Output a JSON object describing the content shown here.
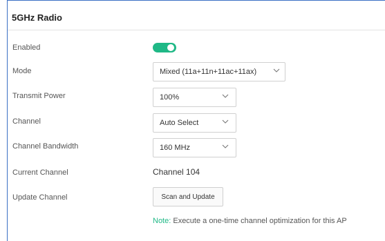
{
  "section": {
    "title": "5GHz Radio"
  },
  "fields": {
    "enabled": {
      "label": "Enabled",
      "value": true
    },
    "mode": {
      "label": "Mode",
      "value": "Mixed (11a+11n+11ac+11ax)"
    },
    "transmit_power": {
      "label": "Transmit Power",
      "value": "100%"
    },
    "channel": {
      "label": "Channel",
      "value": "Auto Select"
    },
    "channel_bandwidth": {
      "label": "Channel Bandwidth",
      "value": "160 MHz"
    },
    "current_channel": {
      "label": "Current Channel",
      "value": "Channel 104"
    },
    "update_channel": {
      "label": "Update Channel",
      "button_label": "Scan and Update"
    }
  },
  "note": {
    "prefix": "Note:",
    "text": " Execute a one-time channel optimization for this AP"
  },
  "colors": {
    "accent": "#1fb886",
    "frame": "#3a6fc4"
  },
  "icons": {
    "dropdown": "chevron-down-icon"
  }
}
